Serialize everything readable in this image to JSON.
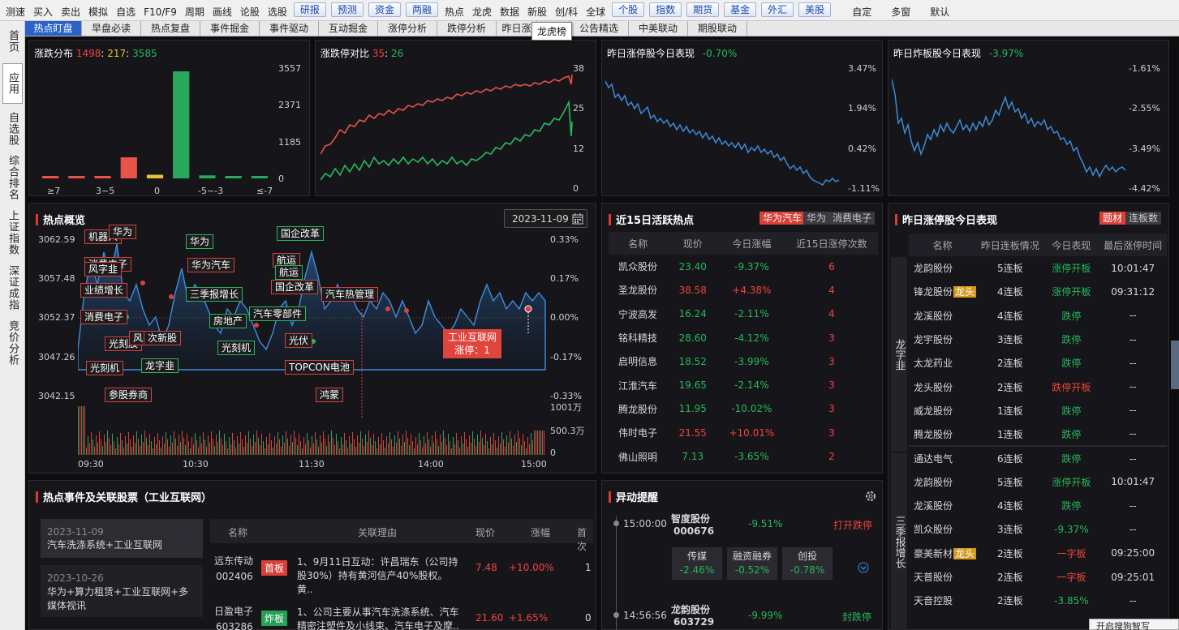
{
  "toolbar": {
    "left": [
      "测速",
      "买入",
      "卖出",
      "模拟",
      "自选",
      "F10/F9",
      "周期",
      "画线",
      "论股",
      "选股"
    ],
    "buttons1": [
      "研报",
      "预测",
      "资金",
      "两融"
    ],
    "mid": [
      "热点",
      "龙虎",
      "数据",
      "新股",
      "创/科",
      "全球"
    ],
    "buttons2": [
      "个股",
      "指数",
      "期货",
      "基金",
      "外汇",
      "美股"
    ],
    "right": [
      "自定",
      "多窗",
      "默认"
    ]
  },
  "leftbar": [
    "首页",
    "应用",
    "自选股",
    "综合排名",
    "上证指数",
    "深证成指",
    "竞价分析"
  ],
  "tabs": [
    "热点盯盘",
    "早盘必读",
    "热点复盘",
    "事件掘金",
    "事件驱动",
    "互动掘金",
    "涨停分析",
    "跌停分析",
    "昨日涨",
    "",
    "公告精选",
    "中美联动",
    "期股联动"
  ],
  "tooltip": "龙虎榜",
  "dist": {
    "title": "涨跌分布",
    "up": "1498",
    "flat": "217",
    "down": "3585",
    "sep": ":",
    "yaxis": [
      "3557",
      "2371",
      "1185",
      "0"
    ],
    "xaxis": [
      "≥7",
      "3~5",
      "0",
      "-5~-3",
      "≤-7"
    ],
    "chart_data": {
      "type": "bar",
      "values": [
        35,
        30,
        60,
        700,
        120,
        3557,
        100,
        40,
        30
      ],
      "colors": [
        "red",
        "red",
        "red",
        "red",
        "yellow",
        "green",
        "green",
        "green",
        "green"
      ],
      "ylim": [
        0,
        3557
      ]
    }
  },
  "limit": {
    "title": "涨跌停对比",
    "up": "35",
    "down": "26",
    "sep": ":",
    "yaxis": [
      "38",
      "25",
      "12",
      "0"
    ]
  },
  "yest_limit": {
    "title": "昨日涨停股今日表现",
    "pct": "-0.70%",
    "yaxis": [
      "3.47%",
      "1.94%",
      "0.42%",
      "-1.11%"
    ]
  },
  "yest_broken": {
    "title": "昨日炸板股今日表现",
    "pct": "-3.97%",
    "yaxis": [
      "-1.61%",
      "-2.55%",
      "-3.49%",
      "-4.42%"
    ]
  },
  "overview": {
    "title": "热点概览",
    "date": "2023-11-09",
    "calendar_icon": "calendar-icon",
    "yleft": [
      "3062.59",
      "3057.48",
      "3052.37",
      "3047.26",
      "3042.15"
    ],
    "yright": [
      "0.33%",
      "0.17%",
      "0.00%",
      "-0.17%",
      "-0.33%"
    ],
    "vol": [
      "1001万",
      "500.3万",
      "0"
    ],
    "xaxis": [
      "09:30",
      "10:30",
      "11:30",
      "14:00",
      "15:00"
    ],
    "labels_red": [
      "机器人",
      "华为",
      "消费电子",
      "风字韭",
      "业绩增长",
      "消费电子",
      "光刻胶",
      "风",
      "光刻机",
      "参股券商",
      "次新股",
      "国企改革",
      "华为汽车",
      "航运",
      "国企改革",
      "汽车热管理",
      "光伏",
      "TOPCON电池",
      "鸿蒙"
    ],
    "labels_green": [
      "华为",
      "三季报增长",
      "房地产",
      "汽车零部件",
      "光刻机",
      "龙字韭",
      "航运"
    ],
    "highlight": {
      "name": "工业互联网",
      "sub": "涨停：1"
    }
  },
  "hot15": {
    "title": "近15日活跃热点",
    "chips": [
      "华为汽车",
      "华为",
      "消费电子"
    ],
    "headers": [
      "名称",
      "现价",
      "今日涨幅",
      "近15日涨停次数"
    ],
    "rows": [
      [
        "凯众股份",
        "23.40",
        "-9.37%",
        "6"
      ],
      [
        "圣龙股份",
        "38.58",
        "+4.38%",
        "4"
      ],
      [
        "宁波高发",
        "16.24",
        "-2.11%",
        "4"
      ],
      [
        "铭科精技",
        "28.60",
        "-4.12%",
        "3"
      ],
      [
        "启明信息",
        "18.52",
        "-3.99%",
        "3"
      ],
      [
        "江淮汽车",
        "19.65",
        "-2.14%",
        "3"
      ],
      [
        "腾龙股份",
        "11.95",
        "-10.02%",
        "3"
      ],
      [
        "伟时电子",
        "21.55",
        "+10.01%",
        "3"
      ],
      [
        "佛山照明",
        "7.13",
        "-3.65%",
        "2"
      ]
    ]
  },
  "ystd": {
    "title": "昨日涨停股今日表现",
    "chips": [
      "题材",
      "连板数"
    ],
    "headers": [
      "名称",
      "昨日连板情况",
      "今日表现",
      "最后涨停时间"
    ],
    "group1": "龙字韭",
    "group2": "三季报增长",
    "rows": [
      [
        "龙韵股份",
        "5连板",
        "涨停开板",
        "10:01:47",
        ""
      ],
      [
        "锋龙股份",
        "4连板",
        "涨停开板",
        "09:31:12",
        "龙头"
      ],
      [
        "龙溪股份",
        "4连板",
        "跌停",
        "--",
        ""
      ],
      [
        "龙宇股份",
        "3连板",
        "跌停",
        "--",
        ""
      ],
      [
        "太龙药业",
        "2连板",
        "跌停",
        "--",
        ""
      ],
      [
        "龙头股份",
        "2连板",
        "跌停开板",
        "--",
        ""
      ],
      [
        "威龙股份",
        "1连板",
        "跌停",
        "--",
        ""
      ],
      [
        "腾龙股份",
        "1连板",
        "跌停",
        "--",
        ""
      ],
      [
        "通达电气",
        "6连板",
        "跌停",
        "--",
        ""
      ],
      [
        "龙韵股份",
        "5连板",
        "涨停开板",
        "10:01:47",
        ""
      ],
      [
        "龙溪股份",
        "4连板",
        "跌停",
        "--",
        ""
      ],
      [
        "凯众股份",
        "3连板",
        "-9.37%",
        "--",
        ""
      ],
      [
        "豪美新材",
        "2连板",
        "一字板",
        "09:25:00",
        "龙头"
      ],
      [
        "天普股份",
        "2连板",
        "一字板",
        "09:25:01",
        ""
      ],
      [
        "天音控股",
        "2连板",
        "-3.85%",
        "--",
        ""
      ]
    ]
  },
  "events": {
    "title": "热点事件及关联股票（工业互联网）",
    "list": [
      {
        "date": "2023-11-09",
        "text": "汽车洗涤系统+工业互联网"
      },
      {
        "date": "2023-10-26",
        "text": "华为+算力租赁+工业互联网+多媒体视讯"
      }
    ],
    "headers": [
      "名称",
      "关联理由",
      "现价",
      "涨幅",
      "首次"
    ],
    "rows": [
      {
        "name": "远东传动",
        "code": "002406",
        "tag": "首板",
        "reason": "1、9月11日互动：许昌瑞东（公司持股30%）持有黄河信产40%股权。黄..",
        "price": "7.48",
        "pct": "+10.00%",
        "first": "1"
      },
      {
        "name": "日盈电子",
        "code": "603286",
        "tag": "炸板",
        "reason": "1、公司主要从事汽车洗涤系统、汽车精密注塑件及小线束、汽车电子及摩..",
        "price": "21.60",
        "pct": "+1.65%",
        "first": "0"
      }
    ]
  },
  "alerts": {
    "title": "异动提醒",
    "gear": "gear-icon",
    "items": [
      {
        "time": "15:00:00",
        "name": "智度股份",
        "code": "000676",
        "pct": "-9.51%",
        "status": "打开跌停",
        "sectors": [
          {
            "name": "传媒",
            "pct": "-2.46%"
          },
          {
            "name": "融资融券",
            "pct": "-0.52%"
          },
          {
            "name": "创投",
            "pct": "-0.78%"
          }
        ]
      },
      {
        "time": "14:56:56",
        "name": "龙韵股份",
        "code": "603729",
        "pct": "-9.99%",
        "status": "封跌停"
      }
    ]
  },
  "corner": "开启搜狗智写"
}
